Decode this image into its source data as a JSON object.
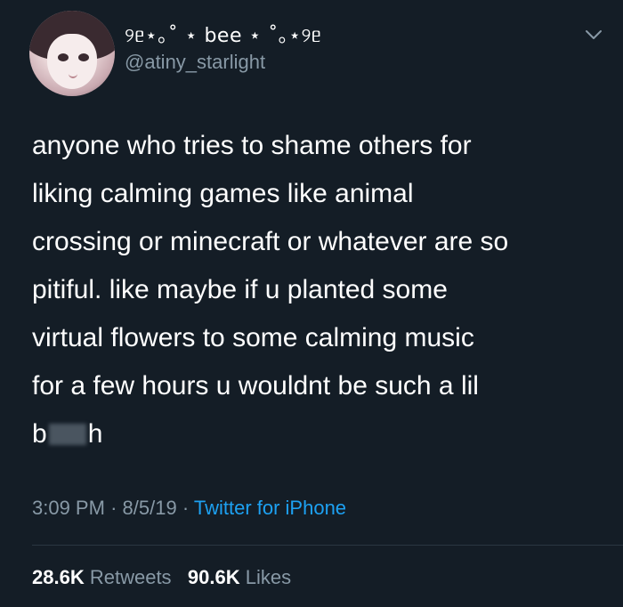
{
  "user": {
    "display_name": "୨ᥱ⋆｡˚ ⋆ bee ⋆ ˚｡⋆୨ᥱ",
    "handle": "@atiny_starlight"
  },
  "tweet": {
    "lines": [
      "anyone who tries to shame others for",
      "liking calming games like animal",
      "crossing or minecraft or whatever are so",
      "pitiful. like maybe if u planted some",
      "virtual flowers to some calming music",
      "for a few hours u wouldnt be such a lil"
    ],
    "last_line_start": "b",
    "last_line_end": "h",
    "time": "3:09 PM",
    "date": "8/5/19",
    "separator": "·",
    "source": "Twitter for iPhone"
  },
  "stats": {
    "retweets_count": "28.6K",
    "retweets_label": "Retweets",
    "likes_count": "90.6K",
    "likes_label": "Likes"
  },
  "icons": {
    "menu": "chevron-down-icon"
  },
  "colors": {
    "background": "#141d26",
    "text": "#ffffff",
    "muted": "#8899a6",
    "link": "#1da1f2"
  }
}
